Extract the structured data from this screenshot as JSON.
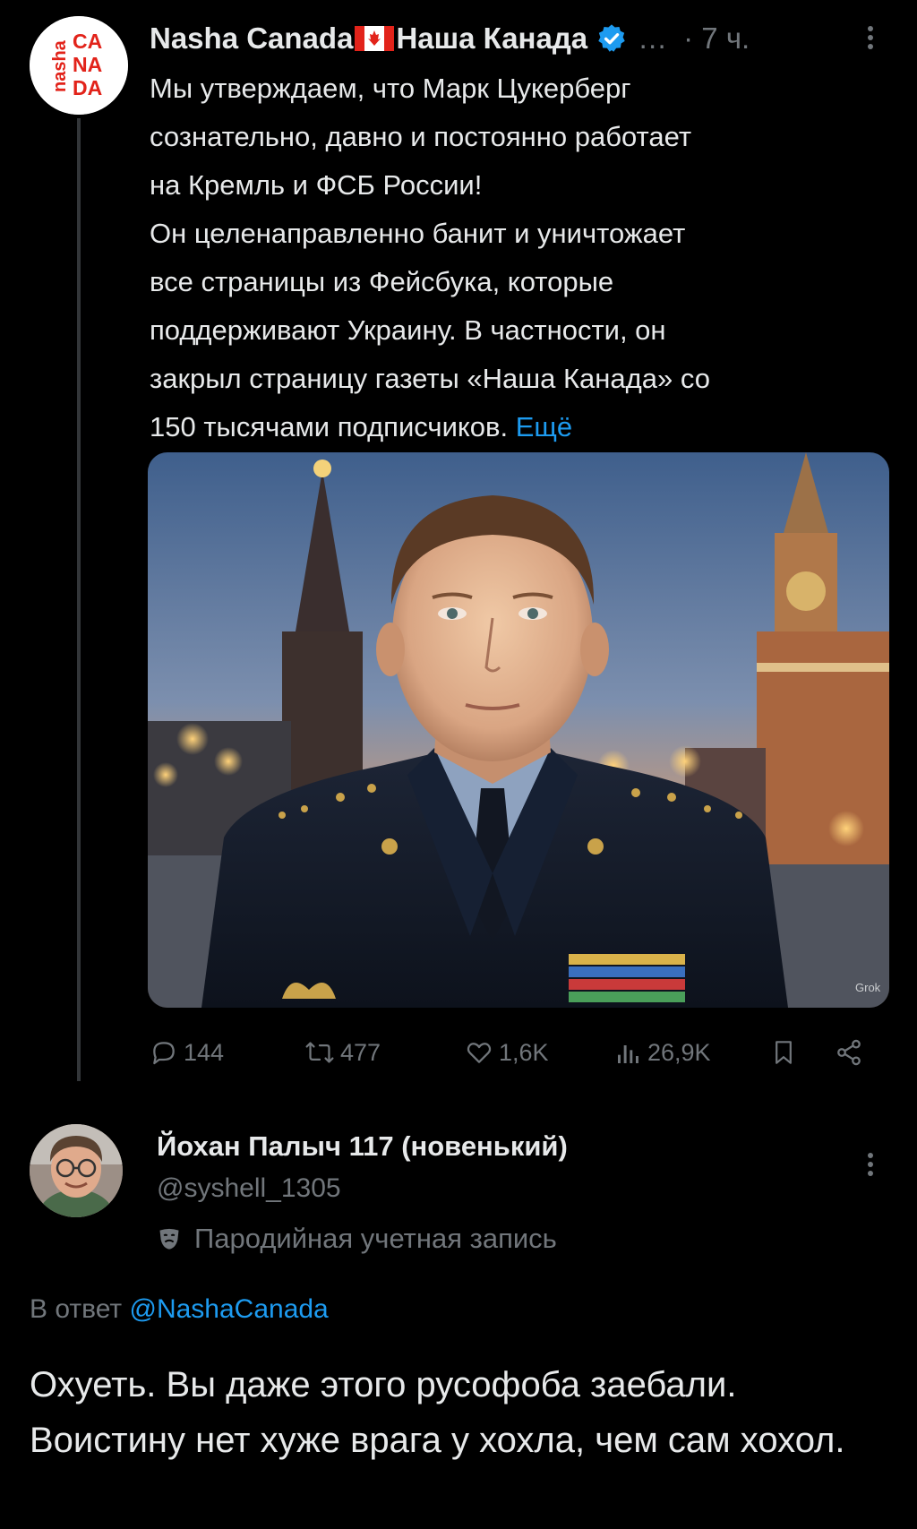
{
  "tweet": {
    "author": {
      "name": "Nasha Canada",
      "name_ru": "Наша Канада",
      "avatar_logo_text": "nasha CANADA",
      "verified": true
    },
    "ellipsis": "…",
    "time": "· 7 ч.",
    "text_lines": [
      "Мы утверждаем, что Марк Цукерберг",
      "сознательно, давно и постоянно работает",
      "на Кремль и ФСБ России!",
      "Он целенаправленно банит и уничтожает",
      "все страницы из Фейсбука, которые",
      "поддерживают Украину. В частности, он",
      "закрыл страницу газеты «Наша Канада» со"
    ],
    "text_last": "150 тысячами подписчиков.",
    "more_link": "Ещё",
    "media": {
      "alt_description_icon": "photo-of-man-in-uniform-with-kremlin-background",
      "watermark": "Grok"
    },
    "actions": {
      "replies": "144",
      "reposts": "477",
      "likes": "1,6K",
      "views": "26,9K"
    }
  },
  "reply": {
    "name": "Йохан Палыч 117 (новенький)",
    "handle": "@syshell_1305",
    "parody_label": "Пародийная учетная запись",
    "reply_to_prefix": "В ответ",
    "reply_to_handle": "@NashaCanada",
    "text": "Охуеть. Вы даже этого русофоба заебали. Воистину нет хуже врага у хохла, чем сам хохол."
  },
  "colors": {
    "background": "#000000",
    "text": "#e7e9ea",
    "muted": "#71767b",
    "link": "#1d9bf0",
    "logo_red": "#e2231a"
  }
}
